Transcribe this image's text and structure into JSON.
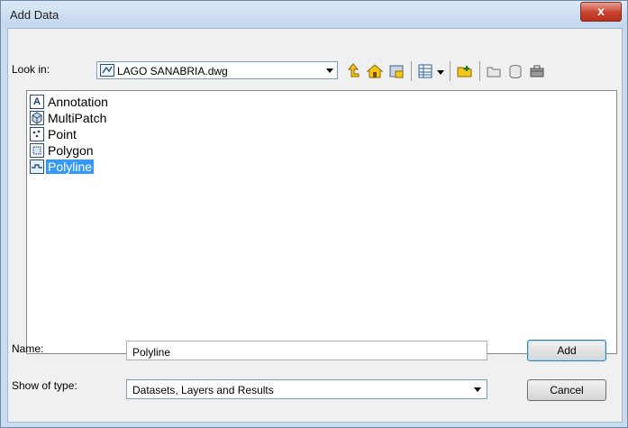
{
  "window": {
    "title": "Add Data",
    "close_glyph": "x"
  },
  "toolbar": {
    "look_in_label": "Look in:",
    "location": "LAGO SANABRIA.dwg",
    "location_icon": "cad-drawing-icon",
    "icons": [
      "go-up-icon",
      "home-icon",
      "catalog-folder-icon",
      "view-list-icon",
      "dropdown-arrow-icon",
      "connect-folder-icon",
      "new-folder-icon",
      "new-geodatabase-icon",
      "new-toolbox-icon"
    ]
  },
  "items": [
    {
      "label": "Annotation",
      "icon": "annotation-icon",
      "glyph": "A",
      "selected": false
    },
    {
      "label": "MultiPatch",
      "icon": "multipatch-icon",
      "glyph": "",
      "selected": false
    },
    {
      "label": "Point",
      "icon": "point-icon",
      "glyph": "",
      "selected": false
    },
    {
      "label": "Polygon",
      "icon": "polygon-icon",
      "glyph": "",
      "selected": false
    },
    {
      "label": "Polyline",
      "icon": "polyline-icon",
      "glyph": "",
      "selected": true
    }
  ],
  "form": {
    "name_label": "Name:",
    "name_value": "Polyline",
    "type_label": "Show of type:",
    "type_value": "Datasets, Layers and Results"
  },
  "buttons": {
    "add": "Add",
    "cancel": "Cancel"
  },
  "colors": {
    "selection": "#3399ff",
    "titlebar": "#c9dbef"
  }
}
